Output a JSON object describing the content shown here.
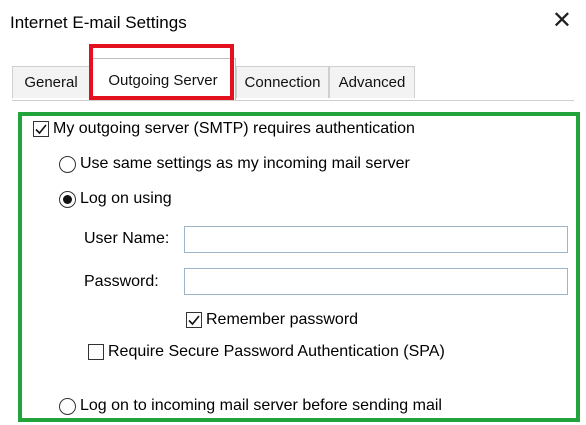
{
  "window": {
    "title": "Internet E-mail Settings",
    "close_label": "✕"
  },
  "tabs": [
    {
      "label": "General"
    },
    {
      "label": "Outgoing Server"
    },
    {
      "label": "Connection"
    },
    {
      "label": "Advanced"
    }
  ],
  "auth": {
    "requires_auth_label": "My outgoing server (SMTP) requires authentication",
    "requires_auth_checked": true,
    "use_same_label": "Use same settings as my incoming mail server",
    "use_same_selected": false,
    "log_on_using_label": "Log on using",
    "log_on_using_selected": true,
    "user_name_label": "User Name:",
    "user_name_value": "",
    "password_label": "Password:",
    "password_value": "",
    "remember_password_label": "Remember password",
    "remember_password_checked": true,
    "spa_label": "Require Secure Password Authentication (SPA)",
    "spa_checked": false,
    "log_on_incoming_label": "Log on to incoming mail server before sending mail",
    "log_on_incoming_selected": false
  },
  "highlight_colors": {
    "tab_highlight": "#e3101e",
    "section_highlight": "#22a33b"
  }
}
